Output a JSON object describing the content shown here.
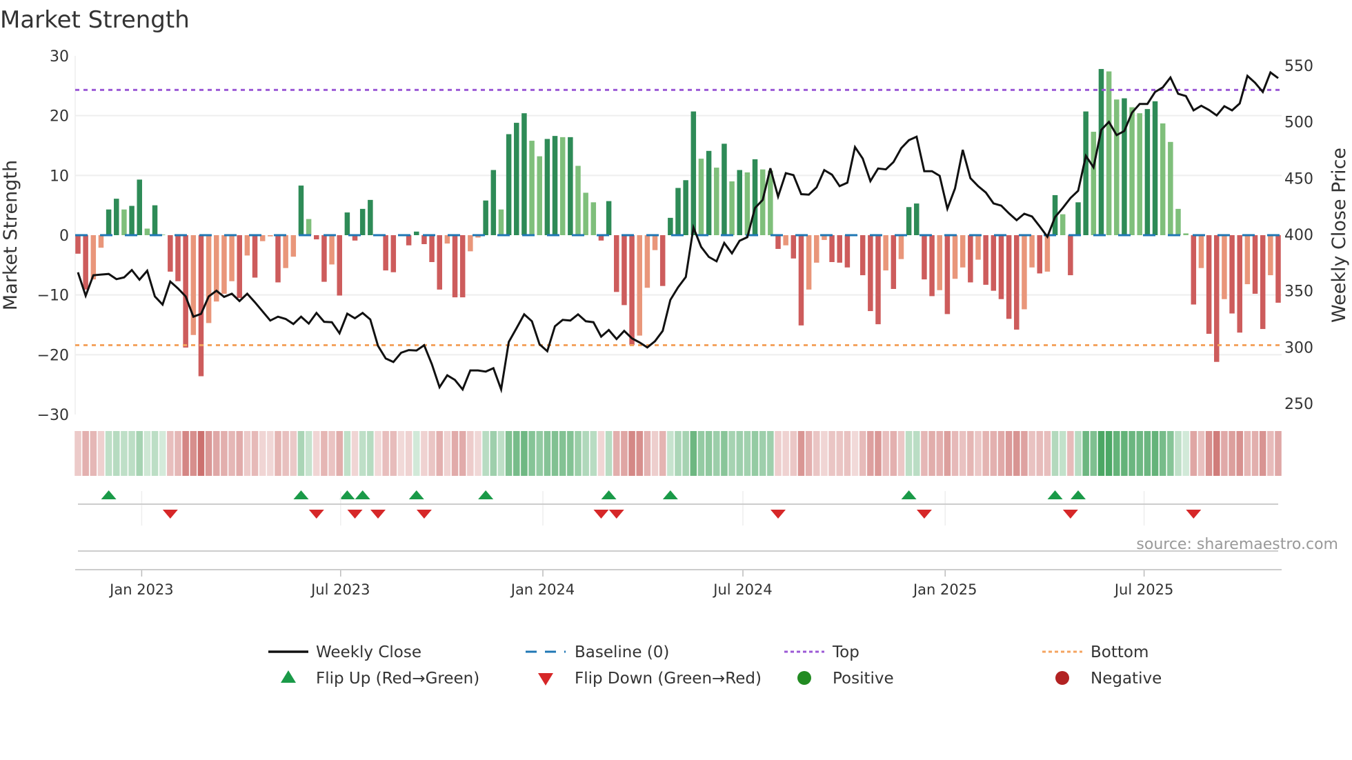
{
  "chart_data": {
    "type": "bar",
    "title": "Market Strength",
    "ylabel": "Market Strength",
    "y2label": "Weekly Close Price",
    "ylim": [
      -30,
      30
    ],
    "y2lim": [
      250,
      550
    ],
    "yticks": [
      30,
      20,
      10,
      0,
      -10,
      -20,
      -30
    ],
    "ytick_labels": [
      "30",
      "20",
      "10",
      "0",
      "−10",
      "−20",
      "−30"
    ],
    "y2ticks": [
      550,
      500,
      450,
      400,
      350,
      300,
      250
    ],
    "y2tick_labels": [
      "550",
      "500",
      "450",
      "400",
      "350",
      "300",
      "250"
    ],
    "grid": true,
    "x_start": "2022-11-04",
    "x_step_days": 7,
    "xticks": [
      {
        "date": "2023-01-01",
        "label": "Jan 2023"
      },
      {
        "date": "2023-07-01",
        "label": "Jul 2023"
      },
      {
        "date": "2024-01-01",
        "label": "Jan 2024"
      },
      {
        "date": "2024-07-01",
        "label": "Jul 2024"
      },
      {
        "date": "2025-01-01",
        "label": "Jan 2025"
      },
      {
        "date": "2025-07-01",
        "label": "Jul 2025"
      }
    ],
    "top_threshold": 24.3,
    "bottom_threshold": -18.4,
    "baseline": 0,
    "strength": [
      -3.1,
      -9.1,
      -7.4,
      -2.1,
      4.3,
      6.1,
      4.3,
      4.9,
      9.3,
      1.1,
      5.0,
      0.1,
      -6.1,
      -7.7,
      -18.8,
      -16.7,
      -23.6,
      -14.7,
      -11.1,
      -9.8,
      -7.7,
      -10.5,
      -3.4,
      -7.1,
      -1.0,
      -0.2,
      -7.9,
      -5.5,
      -3.6,
      8.3,
      2.7,
      -0.7,
      -7.8,
      -4.9,
      -10.1,
      3.8,
      -0.9,
      4.4,
      5.9,
      -0.1,
      -5.9,
      -6.2,
      -0.1,
      -1.7,
      0.6,
      -1.5,
      -4.5,
      -9.1,
      -1.4,
      -10.4,
      -10.4,
      -2.7,
      -0.4,
      5.8,
      10.9,
      4.3,
      16.9,
      18.8,
      20.4,
      15.8,
      13.2,
      16.1,
      16.6,
      16.4,
      16.4,
      11.6,
      7.1,
      5.5,
      -0.9,
      5.7,
      -9.5,
      -11.7,
      -18.4,
      -16.8,
      -8.8,
      -2.5,
      -8.5,
      2.9,
      7.9,
      9.2,
      20.7,
      12.8,
      14.1,
      11.3,
      15.3,
      9.0,
      10.9,
      10.5,
      12.7,
      11.0,
      10.8,
      -2.3,
      -1.7,
      -3.9,
      -15.1,
      -9.1,
      -4.6,
      -0.8,
      -4.5,
      -4.6,
      -5.4,
      -0.1,
      -6.7,
      -12.7,
      -14.9,
      -5.9,
      -9.0,
      -4.0,
      4.7,
      5.3,
      -7.4,
      -10.2,
      -9.2,
      -13.2,
      -7.3,
      -5.4,
      -7.9,
      -4.1,
      -8.3,
      -9.3,
      -10.7,
      -14.0,
      -15.8,
      -12.4,
      -5.4,
      -6.4,
      -6.1,
      6.7,
      3.5,
      -6.7,
      5.5,
      20.7,
      17.3,
      27.8,
      27.4,
      22.7,
      22.9,
      21.4,
      20.4,
      21.1,
      22.4,
      18.7,
      15.6,
      4.4,
      0.3,
      -11.6,
      -5.5,
      -16.5,
      -21.2,
      -10.7,
      -13.1,
      -16.3,
      -8.2,
      -9.8,
      -15.7,
      -6.7,
      -11.3
    ],
    "weekly_close": [
      366.4,
      345.6,
      363.8,
      364.4,
      365,
      360.3,
      361.9,
      368.4,
      359.9,
      367.8,
      345,
      337.8,
      358.2,
      352.1,
      345,
      327,
      329.5,
      345,
      350.1,
      344.6,
      347.4,
      340.9,
      347.4,
      339.9,
      331.7,
      323.6,
      327,
      325,
      320.5,
      327,
      320.9,
      330.3,
      322.5,
      322.1,
      312.3,
      329.7,
      325.6,
      330.3,
      324.6,
      301.1,
      289.9,
      286.8,
      295,
      297.4,
      297,
      301.7,
      284.8,
      264.4,
      275,
      270.9,
      262.4,
      279.3,
      279.3,
      278.3,
      281.3,
      262.4,
      304.6,
      316.8,
      329.1,
      323,
      302.5,
      296.4,
      318.5,
      324.2,
      323.6,
      329.1,
      323,
      322.1,
      309.3,
      315.2,
      307.2,
      314.4,
      307.8,
      304.2,
      299.7,
      305.2,
      314.4,
      341.9,
      353.1,
      362.3,
      406.2,
      388.9,
      380.1,
      376.2,
      392.5,
      383.3,
      394.4,
      397.6,
      423.5,
      430.7,
      458.8,
      433.7,
      454.5,
      452.7,
      435.8,
      435.4,
      441.9,
      457.2,
      453.1,
      442.9,
      446,
      477.6,
      467.4,
      447.4,
      458.6,
      457.8,
      464.3,
      476.6,
      483.7,
      486.8,
      456.2,
      456.2,
      452.1,
      422.9,
      440.9,
      475.1,
      450,
      442.9,
      437.2,
      427.6,
      425.6,
      418.8,
      412.7,
      418.4,
      416,
      407.2,
      398,
      415.4,
      423.5,
      432.3,
      438.8,
      469.8,
      459.6,
      492.9,
      500,
      488.2,
      491.9,
      508.2,
      515.9,
      515.9,
      526.5,
      530.6,
      539.4,
      524.9,
      522.9,
      510.2,
      514.3,
      510.6,
      505.7,
      513.9,
      510.2,
      516.3,
      540.8,
      534.7,
      526.5,
      543.9,
      538.8
    ],
    "colors": {
      "pos_strong": "#2e8b57",
      "pos_weak": "#7fbf7b",
      "neg_strong": "#cd5c5c",
      "neg_weak": "#e9967a",
      "heat_pos": "#3a9e55",
      "heat_neg": "#c0504d",
      "price_line": "#111111",
      "baseline": "#1f77b4",
      "top": "#9b59d6",
      "bottom": "#f4a460",
      "flip_up": "#1a9a48",
      "flip_down": "#d62728",
      "positive": "#228b22",
      "negative": "#b22222"
    },
    "legend": {
      "placement": "bottom",
      "items": [
        {
          "label": "Weekly Close",
          "symbol": "line"
        },
        {
          "label": "Baseline (0)",
          "symbol": "dash"
        },
        {
          "label": "Top",
          "symbol": "dot-purple"
        },
        {
          "label": "Bottom",
          "symbol": "dot-orange"
        },
        {
          "label": "Flip Up (Red→Green)",
          "symbol": "triangle-up"
        },
        {
          "label": "Flip Down (Green→Red)",
          "symbol": "triangle-down"
        },
        {
          "label": "Positive",
          "symbol": "circle-green"
        },
        {
          "label": "Negative",
          "symbol": "circle-red"
        }
      ]
    },
    "source": "source: sharemaestro.com"
  }
}
